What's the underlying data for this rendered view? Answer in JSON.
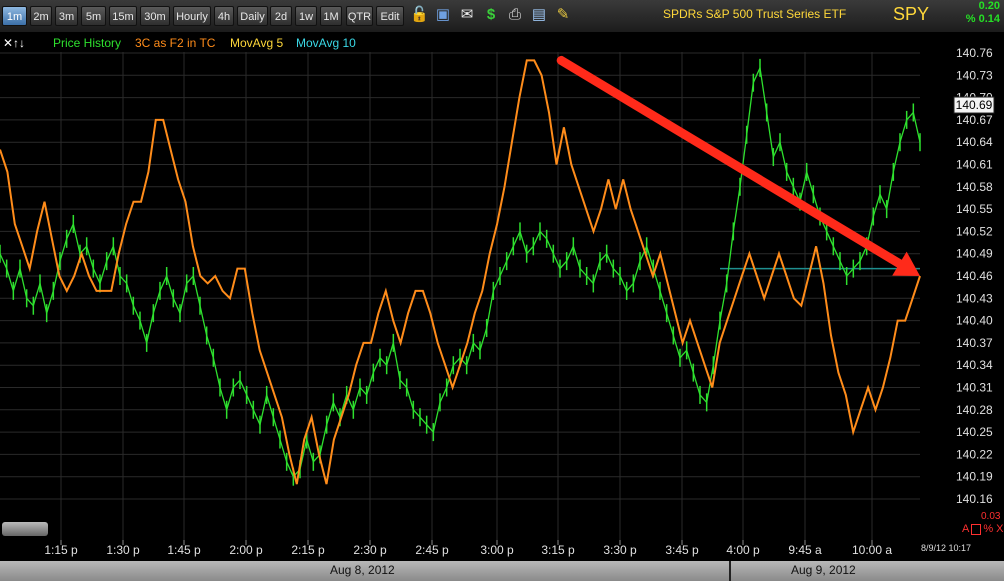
{
  "toolbar": {
    "timeframes": [
      "1m",
      "2m",
      "3m",
      "5m",
      "15m",
      "30m",
      "Hourly",
      "4h",
      "Daily",
      "2d",
      "1w",
      "1M",
      "QTR",
      "Edit"
    ],
    "active": "1m",
    "icons": [
      "lock-icon",
      "save-icon",
      "email-icon",
      "dollar-icon",
      "print-icon",
      "window-icon",
      "pencil-icon"
    ]
  },
  "header": {
    "symbol_name": "SPDRs S&P 500 Trust Series ETF",
    "ticker": "SPY",
    "change_abs": "0.20",
    "change_pct": "% 0.14"
  },
  "legend": {
    "nav_glyphs": "✕↑↓",
    "items": [
      {
        "label": "Price History",
        "color": "#2ee02e"
      },
      {
        "label": "3C as F2 in TC",
        "color": "#ff8c1a"
      },
      {
        "label": "MovAvg 5",
        "color": "#ffd83a"
      },
      {
        "label": "MovAvg 10",
        "color": "#3ad8e6"
      }
    ]
  },
  "right_panel": {
    "bottom_value": "0.03",
    "marker_text": "A",
    "marker_suffix": "% X",
    "datetime": "8/9/12 10:17"
  },
  "dates": [
    "Aug 8, 2012",
    "Aug 9, 2012"
  ],
  "colors": {
    "price": "#2ee02e",
    "indicator": "#ff8c1a",
    "arrow": "#ff2a1a",
    "maline": "#1f8f8f",
    "grid": "#2a2a2a"
  },
  "chart_data": {
    "type": "line",
    "ylim": [
      140.145,
      140.785
    ],
    "yticks": [
      "140.76",
      "140.73",
      "140.70",
      "140.67",
      "140.64",
      "140.61",
      "140.58",
      "140.55",
      "140.52",
      "140.49",
      "140.46",
      "140.43",
      "140.40",
      "140.37",
      "140.34",
      "140.31",
      "140.28",
      "140.25",
      "140.22",
      "140.19",
      "140.16"
    ],
    "price_label": "140.69",
    "xticks": [
      "1:15 p",
      "1:30 p",
      "1:45 p",
      "2:00 p",
      "2:15 p",
      "2:30 p",
      "2:45 p",
      "3:00 p",
      "3:15 p",
      "3:30 p",
      "3:45 p",
      "4:00 p",
      "9:45 a",
      "10:00 a"
    ],
    "series": [
      {
        "name": "Price History",
        "y": [
          140.49,
          140.47,
          140.44,
          140.47,
          140.43,
          140.42,
          140.45,
          140.41,
          140.44,
          140.48,
          140.51,
          140.53,
          140.49,
          140.5,
          140.47,
          140.45,
          140.48,
          140.5,
          140.46,
          140.45,
          140.42,
          140.4,
          140.37,
          140.41,
          140.44,
          140.46,
          140.43,
          140.41,
          140.45,
          140.46,
          140.42,
          140.38,
          140.35,
          140.31,
          140.28,
          140.31,
          140.32,
          140.3,
          140.28,
          140.26,
          140.3,
          140.27,
          140.24,
          140.21,
          140.19,
          140.2,
          140.24,
          140.21,
          140.22,
          140.26,
          140.29,
          140.27,
          140.3,
          140.28,
          140.31,
          140.3,
          140.33,
          140.35,
          140.34,
          140.37,
          140.32,
          140.31,
          140.28,
          140.27,
          140.26,
          140.25,
          140.29,
          140.31,
          140.34,
          140.35,
          140.34,
          140.37,
          140.36,
          140.39,
          140.44,
          140.46,
          140.48,
          140.5,
          140.52,
          140.49,
          140.5,
          140.52,
          140.51,
          140.49,
          140.47,
          140.48,
          140.5,
          140.47,
          140.46,
          140.45,
          140.48,
          140.49,
          140.47,
          140.46,
          140.44,
          140.45,
          140.48,
          140.5,
          140.47,
          140.44,
          140.41,
          140.38,
          140.35,
          140.36,
          140.33,
          140.3,
          140.29,
          140.34,
          140.4,
          140.45,
          140.52,
          140.58,
          140.65,
          140.72,
          140.74,
          140.68,
          140.62,
          140.64,
          140.6,
          140.58,
          140.56,
          140.6,
          140.57,
          140.54,
          140.52,
          140.5,
          140.48,
          140.46,
          140.47,
          140.48,
          140.5,
          140.54,
          140.57,
          140.55,
          140.6,
          140.64,
          140.67,
          140.68,
          140.64
        ],
        "color": "#2ee02e"
      },
      {
        "name": "3C as F2 in TC",
        "y": [
          140.63,
          140.6,
          140.53,
          140.5,
          140.47,
          140.52,
          140.56,
          140.51,
          140.46,
          140.44,
          140.46,
          140.49,
          140.46,
          140.44,
          140.44,
          140.44,
          140.49,
          140.53,
          140.56,
          140.56,
          140.6,
          140.67,
          140.67,
          140.63,
          140.59,
          140.56,
          140.5,
          140.46,
          140.45,
          140.46,
          140.44,
          140.43,
          140.47,
          140.47,
          140.41,
          140.36,
          140.33,
          140.3,
          140.27,
          140.22,
          140.18,
          140.24,
          140.27,
          140.22,
          140.18,
          140.24,
          140.27,
          140.3,
          140.34,
          140.37,
          140.37,
          140.41,
          140.44,
          140.4,
          140.37,
          140.41,
          140.44,
          140.44,
          140.41,
          140.37,
          140.34,
          140.31,
          140.34,
          140.37,
          140.41,
          140.44,
          140.49,
          140.53,
          140.58,
          140.64,
          140.7,
          140.75,
          140.75,
          140.73,
          140.68,
          140.61,
          140.66,
          140.61,
          140.58,
          140.55,
          140.52,
          140.55,
          140.59,
          140.55,
          140.59,
          140.55,
          140.52,
          140.49,
          140.46,
          140.49,
          140.45,
          140.41,
          140.37,
          140.4,
          140.37,
          140.34,
          140.31,
          140.37,
          140.4,
          140.43,
          140.46,
          140.49,
          140.46,
          140.43,
          140.46,
          140.49,
          140.46,
          140.43,
          140.42,
          140.46,
          140.5,
          140.45,
          140.38,
          140.33,
          140.3,
          140.25,
          140.28,
          140.31,
          140.28,
          140.31,
          140.35,
          140.4,
          140.4,
          140.43,
          140.46
        ],
        "color": "#ff8c1a"
      }
    ],
    "moving_average_level": 140.47,
    "annotation": {
      "type": "arrow",
      "from": [
        0.61,
        140.75
      ],
      "to": [
        1.0,
        140.46
      ],
      "color": "#ff2a1a"
    },
    "grid": true
  }
}
